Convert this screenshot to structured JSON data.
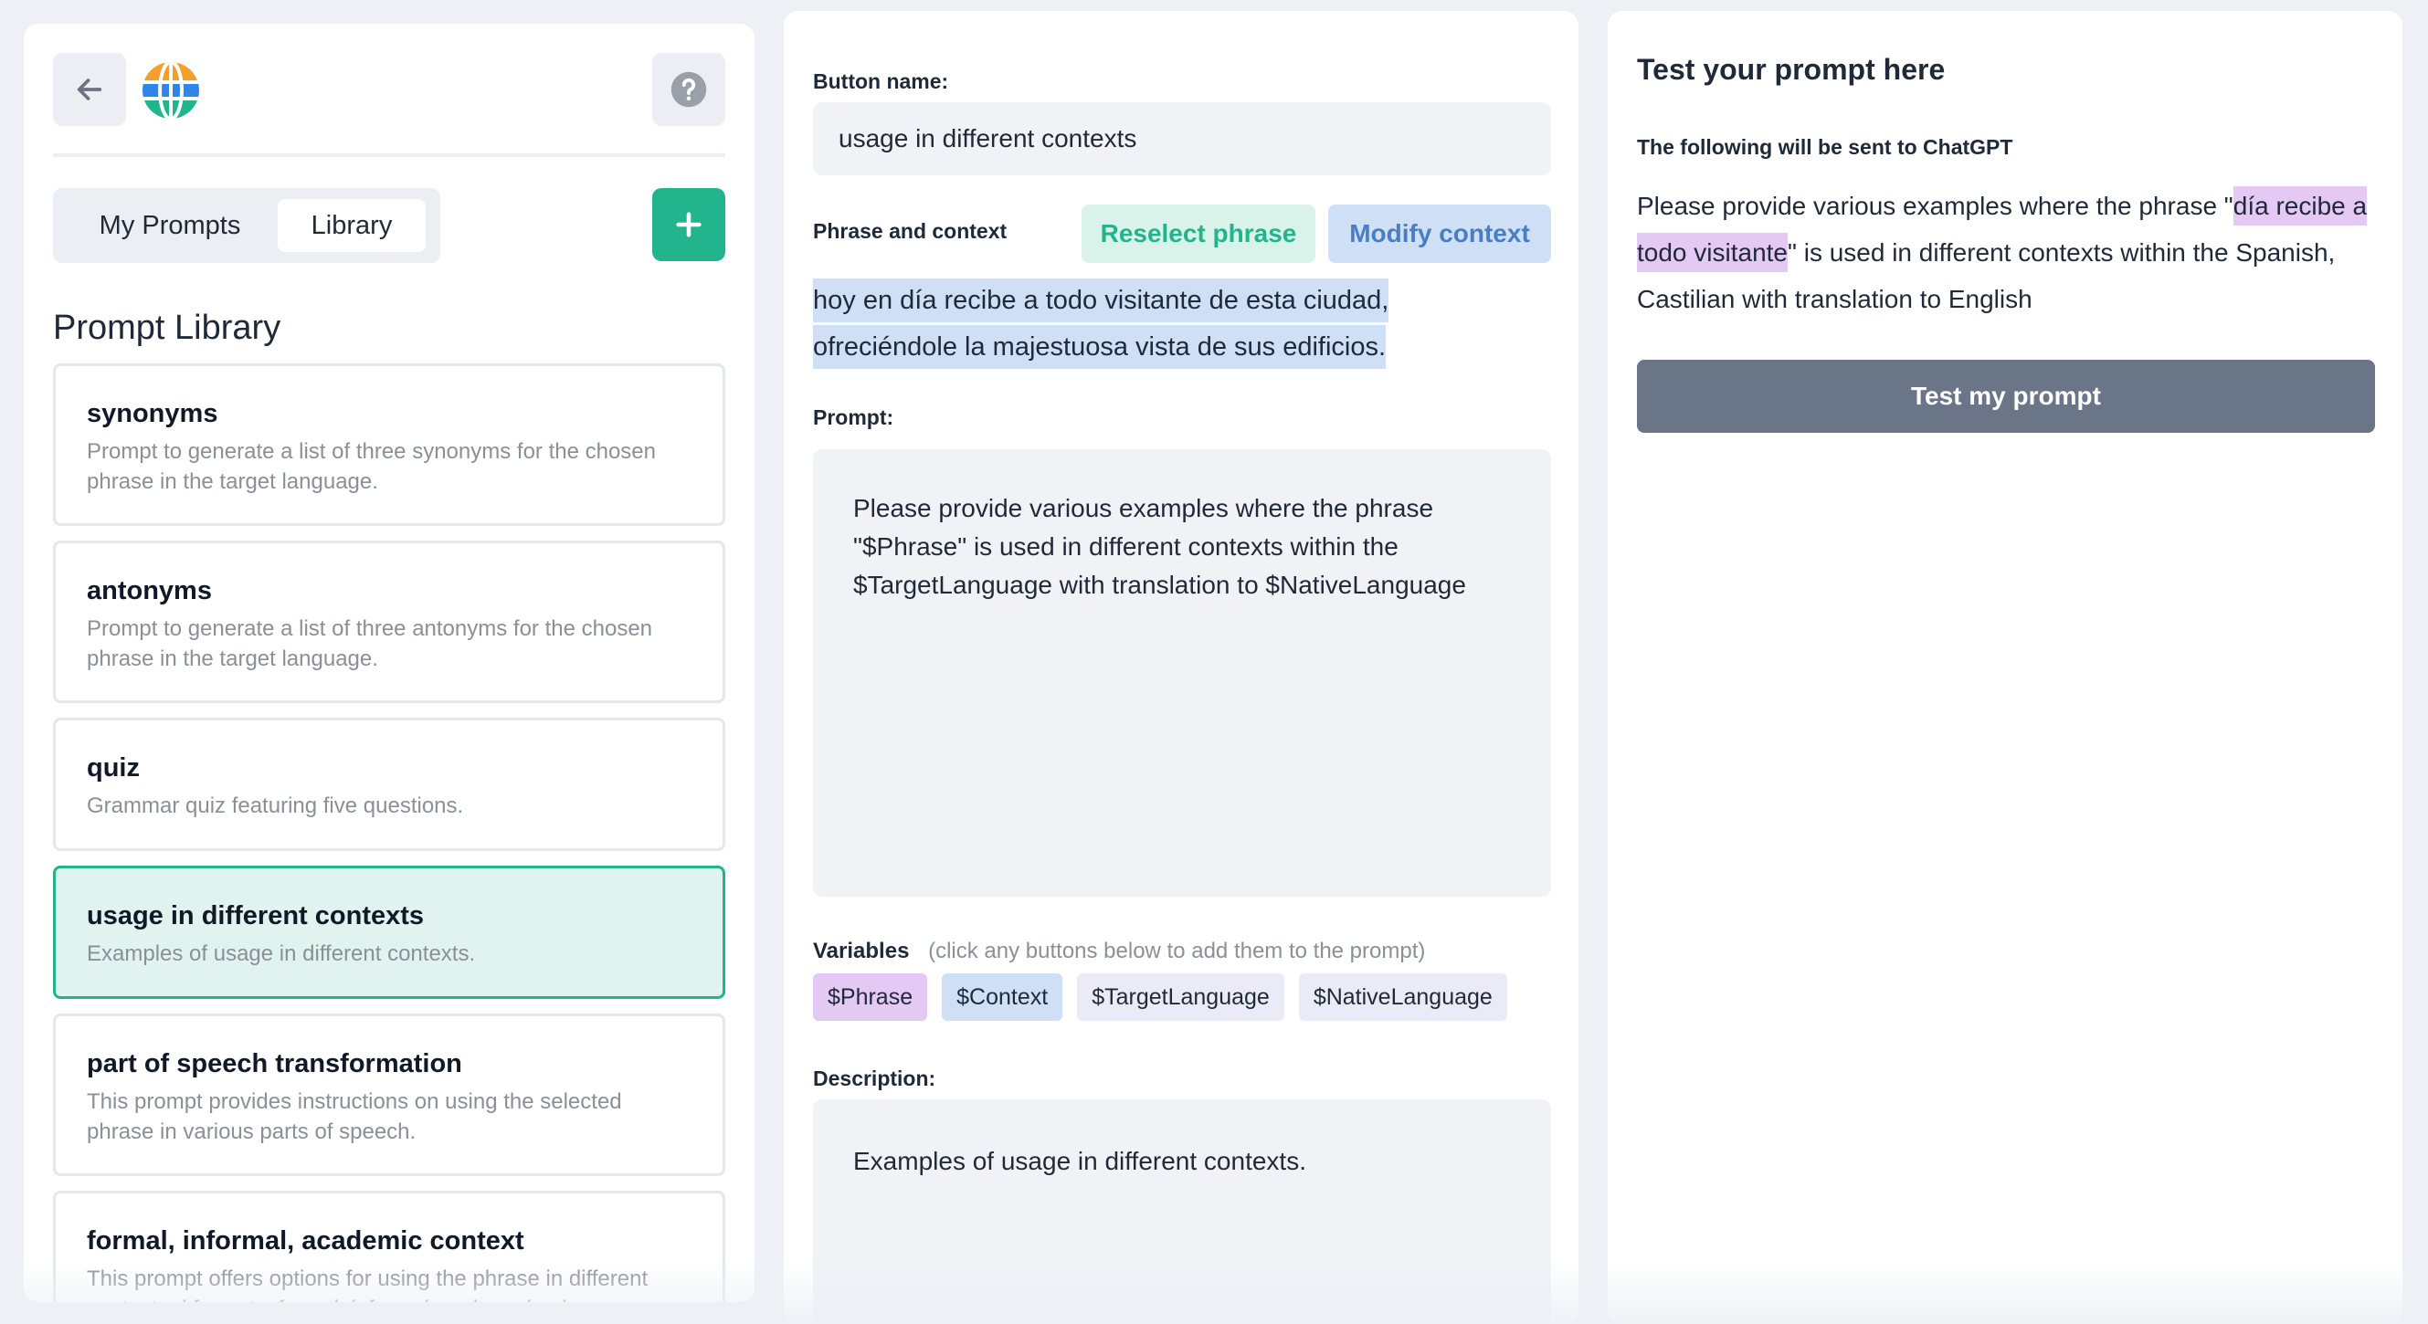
{
  "left": {
    "tabs": [
      "My Prompts",
      "Library"
    ],
    "library_title": "Prompt Library",
    "cards": [
      {
        "title": "synonyms",
        "desc": "Prompt to generate a list of three synonyms for the chosen phrase in the target language."
      },
      {
        "title": "antonyms",
        "desc": "Prompt to generate a list of three antonyms for the chosen phrase in the target language."
      },
      {
        "title": "quiz",
        "desc": "Grammar quiz featuring five questions."
      },
      {
        "title": "usage in different contexts",
        "desc": "Examples of usage in different contexts.",
        "active": true
      },
      {
        "title": "part of speech transformation",
        "desc": "This prompt provides instructions on using the selected phrase in various parts of speech."
      },
      {
        "title": "formal, informal, academic context",
        "desc": "This prompt offers options for using the phrase in different contextual formats: formal, informal, and academic."
      }
    ]
  },
  "middle": {
    "button_name_label": "Button name:",
    "button_name_value": "usage in different contexts",
    "phrase_context_label": "Phrase and context",
    "reselect_label": "Reselect phrase",
    "modify_label": "Modify context",
    "context_line1": "hoy en día recibe a todo visitante de esta ciudad,",
    "context_line2": "ofreciéndole la majestuosa vista de sus edificios.",
    "prompt_label": "Prompt:",
    "prompt_value": "Please provide various examples where  the phrase \"$Phrase\" is used in different contexts within the $TargetLanguage with translation to $NativeLanguage",
    "variables_label": "Variables",
    "variables_hint": "(click any buttons below to add them to the prompt)",
    "variables": [
      "$Phrase",
      "$Context",
      "$TargetLanguage",
      "$NativeLanguage"
    ],
    "description_label": "Description:",
    "description_value": "Examples of usage in different contexts."
  },
  "right": {
    "title": "Test your prompt here",
    "sent_label": "The following will be sent to ChatGPT",
    "preview_before": "Please provide various examples where the phrase \"",
    "preview_phrase": "día recibe a todo visitante",
    "preview_after": "\" is used in different contexts within the Spanish, Castilian with translation to English",
    "test_button": "Test my prompt"
  },
  "colors": {
    "accent": "#22b48c",
    "context_blue": "#cfe0f6",
    "phrase_purple": "#e4c9f5",
    "test_button": "#6b7588"
  },
  "icons": [
    "arrow-left-icon",
    "globe-icon",
    "question-icon",
    "plus-icon"
  ]
}
